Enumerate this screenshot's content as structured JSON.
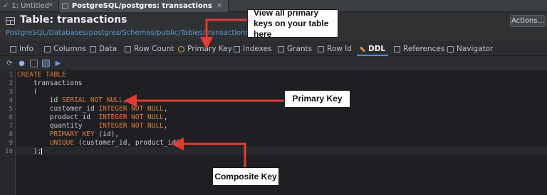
{
  "editor_tabs": [
    {
      "label": "1: Untitled*"
    },
    {
      "label": "PostgreSQL/postgres: transactions"
    }
  ],
  "header": {
    "title": "Table: transactions",
    "breadcrumb": "PostgreSQL/Databases/postgres/Schemas/public/Tables/transactions",
    "actions_label": "Actions..."
  },
  "prop_tabs": [
    {
      "label": "Info",
      "icon": "info-icon"
    },
    {
      "label": "Columns",
      "icon": "columns-icon"
    },
    {
      "label": "Data",
      "icon": "data-icon"
    },
    {
      "label": "Row Count",
      "icon": "row-count-icon"
    },
    {
      "label": "Primary Key",
      "icon": "key-icon"
    },
    {
      "label": "Indexes",
      "icon": "indexes-icon"
    },
    {
      "label": "Grants",
      "icon": "grants-icon"
    },
    {
      "label": "Row Id",
      "icon": "row-id-icon"
    },
    {
      "label": "DDL",
      "icon": "ddl-icon",
      "active": true
    },
    {
      "label": "References",
      "icon": "references-icon"
    },
    {
      "label": "Navigator",
      "icon": "navigator-icon"
    }
  ],
  "toolbar": {
    "icons": [
      "refresh-icon",
      "stop-icon",
      "new-document-icon",
      "copy-icon",
      "run-icon"
    ]
  },
  "editor": {
    "line_numbers": [
      "1",
      "2",
      "3",
      "4",
      "5",
      "6",
      "7",
      "8",
      "9",
      "10"
    ],
    "lines": [
      [
        {
          "t": "CREATE TABLE",
          "kw": true
        }
      ],
      [
        {
          "t": "    transactions"
        }
      ],
      [
        {
          "t": "    ("
        }
      ],
      [
        {
          "t": "        id "
        },
        {
          "t": "SERIAL NOT NULL",
          "kw": true
        },
        {
          "t": ","
        }
      ],
      [
        {
          "t": "        customer_id "
        },
        {
          "t": "INTEGER NOT NULL",
          "kw": true
        },
        {
          "t": ","
        }
      ],
      [
        {
          "t": "        product_id  "
        },
        {
          "t": "INTEGER NOT NULL",
          "kw": true
        },
        {
          "t": ","
        }
      ],
      [
        {
          "t": "        quantity    "
        },
        {
          "t": "INTEGER NOT NULL",
          "kw": true
        },
        {
          "t": ","
        }
      ],
      [
        {
          "t": "        "
        },
        {
          "t": "PRIMARY KEY",
          "kw": true
        },
        {
          "t": " (id),"
        }
      ],
      [
        {
          "t": "        "
        },
        {
          "t": "UNIQUE",
          "kw": true
        },
        {
          "t": " (customer_id, product_id)"
        }
      ],
      [
        {
          "t": "    );"
        }
      ]
    ]
  },
  "annotations": {
    "view_keys": "View all primary keys on your table here",
    "primary_key": "Primary Key",
    "composite_key": "Composite Key"
  },
  "colors": {
    "keyword": "#e07b39",
    "arrow": "#e53a2f",
    "link": "#5b9bd8",
    "active_tab_underline": "#4a90e2"
  }
}
